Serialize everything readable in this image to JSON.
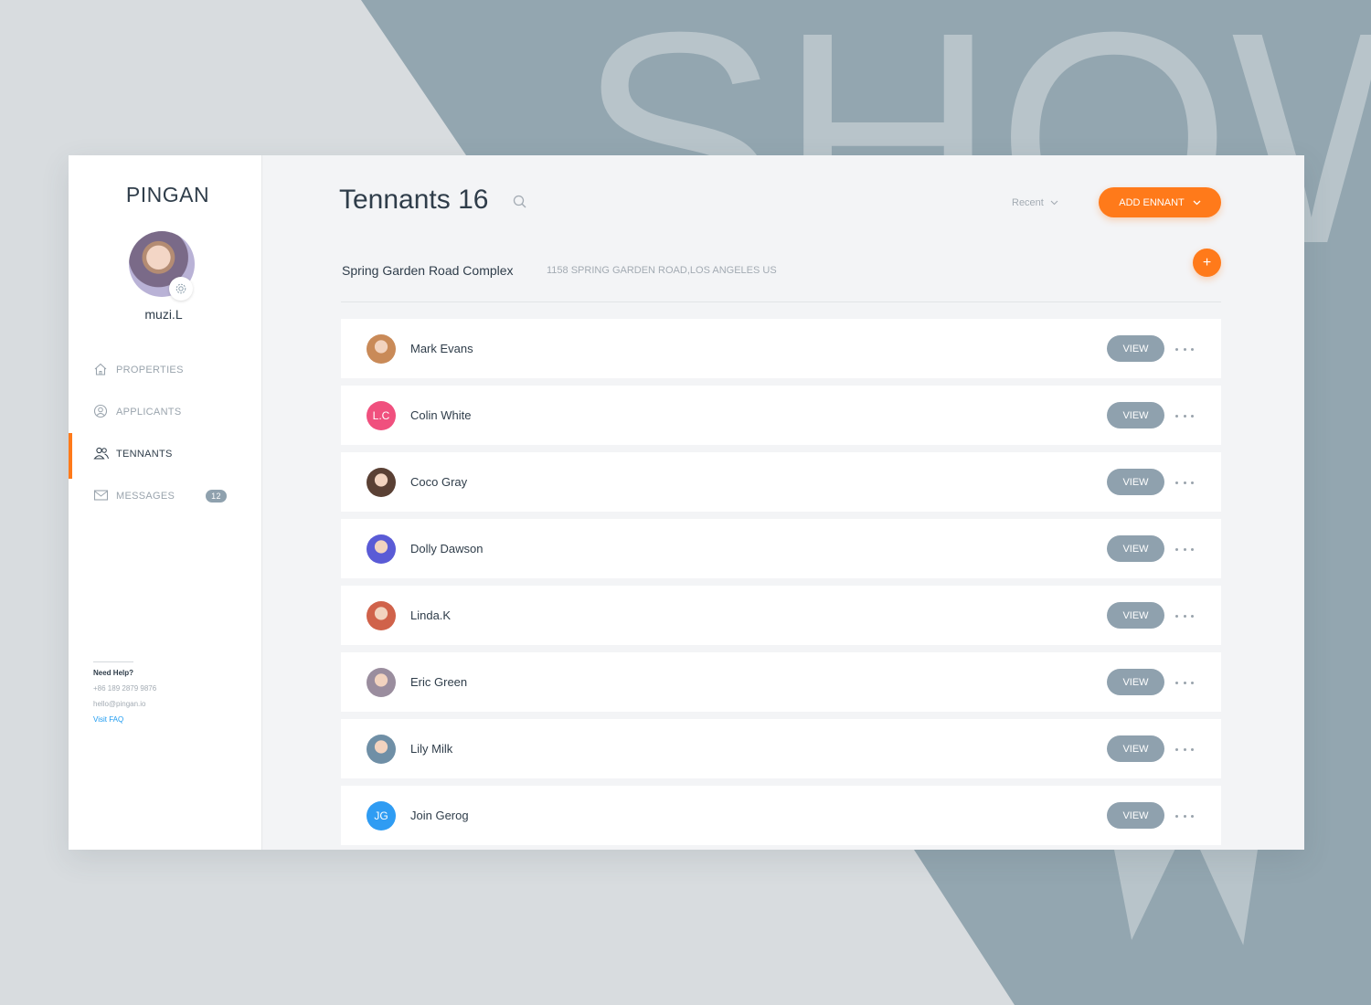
{
  "app": {
    "brand": "PINGAN",
    "backdrop_letters": "SHOW",
    "accent_color": "#ff7a1a",
    "button_gray": "#8fa1ae"
  },
  "sidebar": {
    "username": "muzi.L",
    "items": [
      {
        "label": "PROPERTIES",
        "icon": "home-icon",
        "active": false
      },
      {
        "label": "APPLICANTS",
        "icon": "user-circle-icon",
        "active": false
      },
      {
        "label": "TENNANTS",
        "icon": "users-icon",
        "active": true
      },
      {
        "label": "MESSAGES",
        "icon": "mail-icon",
        "active": false,
        "badge": "12"
      }
    ],
    "help": {
      "title": "Need Help?",
      "phone": "+86 189 2879 9876",
      "email": "hello@pingan.io",
      "faq_link": "Visit FAQ"
    }
  },
  "header": {
    "title": "Tennants 16",
    "sort_label": "Recent",
    "add_button_label": "ADD ENNANT"
  },
  "property": {
    "name": "Spring Garden Road Complex",
    "address": "1158 SPRING GARDEN ROAD,LOS ANGELES US",
    "add_symbol": "+"
  },
  "tenants": [
    {
      "name": "Mark Evans",
      "avatar": "photo",
      "color": "#c98a58"
    },
    {
      "name": "Colin White",
      "avatar": "initials",
      "initials": "L.C",
      "color": "#f0507e"
    },
    {
      "name": "Coco Gray",
      "avatar": "photo",
      "color": "#5a4034"
    },
    {
      "name": "Dolly Dawson",
      "avatar": "photo",
      "color": "#5a5bd6"
    },
    {
      "name": "Linda.K",
      "avatar": "photo",
      "color": "#d0624a"
    },
    {
      "name": "Eric Green",
      "avatar": "photo",
      "color": "#9a8d9e"
    },
    {
      "name": "Lily Milk",
      "avatar": "photo",
      "color": "#6f8fa6"
    },
    {
      "name": "Join Gerog",
      "avatar": "initials",
      "initials": "JG",
      "color": "#2f9cf3"
    }
  ],
  "row_action_label": "VIEW"
}
